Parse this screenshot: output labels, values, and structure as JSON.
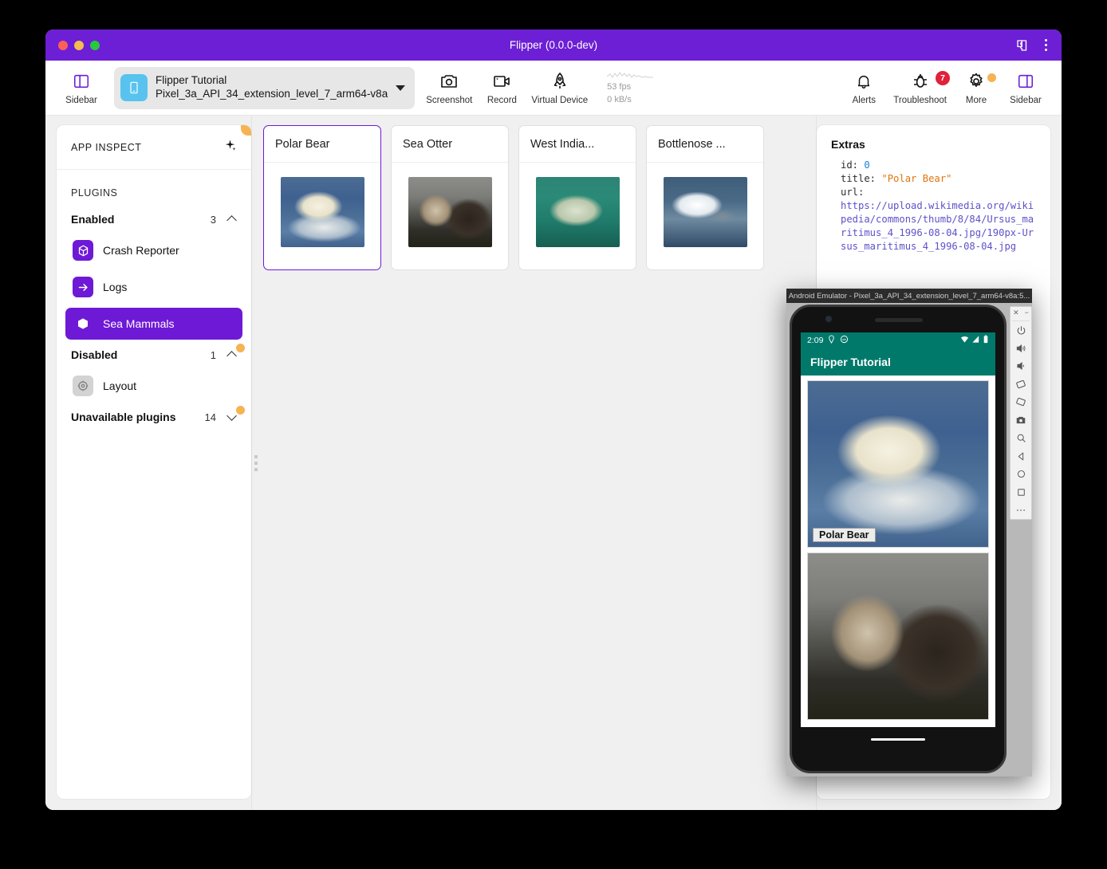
{
  "window": {
    "title": "Flipper (0.0.0-dev)",
    "accent": "#6c1fd4",
    "traffic": [
      "close",
      "minimize",
      "zoom"
    ]
  },
  "toolbar": {
    "sidebar_left_label": "Sidebar",
    "device": {
      "name": "Flipper Tutorial",
      "sub": "Pixel_3a_API_34_extension_level_7_arm64-v8a"
    },
    "screenshot_label": "Screenshot",
    "record_label": "Record",
    "virtual_device_label": "Virtual Device",
    "perf": {
      "fps": "53 fps",
      "net": "0 kB/s"
    },
    "alerts_label": "Alerts",
    "troubleshoot_label": "Troubleshoot",
    "troubleshoot_badge": "7",
    "more_label": "More",
    "sidebar_right_label": "Sidebar"
  },
  "sidebar": {
    "app_inspect_title": "APP INSPECT",
    "plugins_title": "PLUGINS",
    "groups": [
      {
        "label": "Enabled",
        "count": "3",
        "expanded": true
      },
      {
        "label": "Disabled",
        "count": "1",
        "expanded": true
      },
      {
        "label": "Unavailable plugins",
        "count": "14",
        "expanded": false
      }
    ],
    "enabled": [
      {
        "label": "Crash Reporter",
        "icon": "cube-icon",
        "selected": false
      },
      {
        "label": "Logs",
        "icon": "arrow-right-icon",
        "selected": false
      },
      {
        "label": "Sea Mammals",
        "icon": "cube-icon",
        "selected": true
      }
    ],
    "disabled": [
      {
        "label": "Layout",
        "icon": "target-icon",
        "selected": false
      }
    ]
  },
  "cards": [
    {
      "title": "Polar Bear",
      "selected": true
    },
    {
      "title": "Sea Otter",
      "selected": false
    },
    {
      "title": "West India...",
      "selected": false
    },
    {
      "title": "Bottlenose ...",
      "selected": false
    }
  ],
  "extras": {
    "title": "Extras",
    "id_key": "id:",
    "id_value": "0",
    "title_key": "title:",
    "title_value": "\"Polar Bear\"",
    "url_key": "url:",
    "url_value": "https://upload.wikimedia.org/wikipedia/commons/thumb/8/84/Ursus_maritimus_4_1996-08-04.jpg/190px-Ursus_maritimus_4_1996-08-04.jpg"
  },
  "emulator": {
    "window_title": "Android Emulator - Pixel_3a_API_34_extension_level_7_arm64-v8a:5...",
    "status_time": "2:09",
    "app_title": "Flipper Tutorial",
    "items": [
      {
        "caption": "Polar Bear"
      },
      {
        "caption": ""
      }
    ],
    "controls": [
      "close-icon",
      "minimize-icon",
      "power-icon",
      "volume-up-icon",
      "volume-down-icon",
      "rotate-left-icon",
      "rotate-right-icon",
      "screenshot-icon",
      "zoom-icon",
      "back-icon",
      "home-icon",
      "overview-icon",
      "more-icon"
    ]
  }
}
